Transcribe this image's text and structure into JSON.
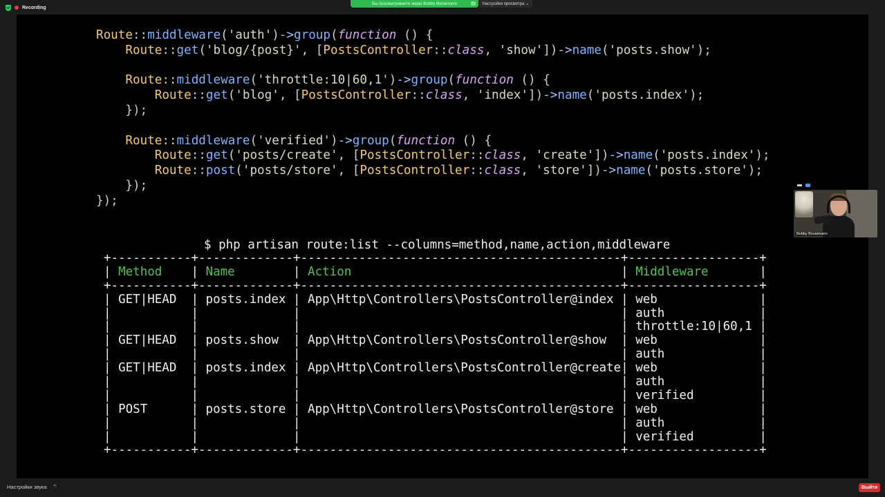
{
  "topbar": {
    "recording_label": "Recording",
    "share_banner_text": "Вы просматриваете экран Bobby Bouwmann",
    "view_options_label": "Настройки просмотра",
    "view_options_caret": "⌄"
  },
  "code_lines": [
    [
      {
        "c": "k-route",
        "t": "Route"
      },
      {
        "c": "k-pun",
        "t": "::"
      },
      {
        "c": "k-fn",
        "t": "middleware"
      },
      {
        "c": "k-pun",
        "t": "("
      },
      {
        "c": "k-str",
        "t": "'auth'"
      },
      {
        "c": "k-pun",
        "t": ")"
      },
      {
        "c": "k-arrow",
        "t": "->"
      },
      {
        "c": "k-fn",
        "t": "group"
      },
      {
        "c": "k-pun",
        "t": "("
      },
      {
        "c": "k-kw",
        "t": "function"
      },
      {
        "c": "k-pun",
        "t": " () {"
      }
    ],
    [
      {
        "c": "k-pun",
        "t": "    "
      },
      {
        "c": "k-route",
        "t": "Route"
      },
      {
        "c": "k-pun",
        "t": "::"
      },
      {
        "c": "k-fn",
        "t": "get"
      },
      {
        "c": "k-pun",
        "t": "("
      },
      {
        "c": "k-str",
        "t": "'blog/{post}'"
      },
      {
        "c": "k-pun",
        "t": ", ["
      },
      {
        "c": "k-cls",
        "t": "PostsController"
      },
      {
        "c": "k-pun",
        "t": "::"
      },
      {
        "c": "k-kw",
        "t": "class"
      },
      {
        "c": "k-pun",
        "t": ", "
      },
      {
        "c": "k-str",
        "t": "'show'"
      },
      {
        "c": "k-pun",
        "t": "])"
      },
      {
        "c": "k-arrow",
        "t": "->"
      },
      {
        "c": "k-fn",
        "t": "name"
      },
      {
        "c": "k-pun",
        "t": "("
      },
      {
        "c": "k-str",
        "t": "'posts.show'"
      },
      {
        "c": "k-pun",
        "t": ");"
      }
    ],
    [],
    [
      {
        "c": "k-pun",
        "t": "    "
      },
      {
        "c": "k-route",
        "t": "Route"
      },
      {
        "c": "k-pun",
        "t": "::"
      },
      {
        "c": "k-fn",
        "t": "middleware"
      },
      {
        "c": "k-pun",
        "t": "("
      },
      {
        "c": "k-str",
        "t": "'throttle:10|60,1'"
      },
      {
        "c": "k-pun",
        "t": ")"
      },
      {
        "c": "k-arrow",
        "t": "->"
      },
      {
        "c": "k-fn",
        "t": "group"
      },
      {
        "c": "k-pun",
        "t": "("
      },
      {
        "c": "k-kw",
        "t": "function"
      },
      {
        "c": "k-pun",
        "t": " () {"
      }
    ],
    [
      {
        "c": "k-pun",
        "t": "        "
      },
      {
        "c": "k-route",
        "t": "Route"
      },
      {
        "c": "k-pun",
        "t": "::"
      },
      {
        "c": "k-fn",
        "t": "get"
      },
      {
        "c": "k-pun",
        "t": "("
      },
      {
        "c": "k-str",
        "t": "'blog'"
      },
      {
        "c": "k-pun",
        "t": ", ["
      },
      {
        "c": "k-cls",
        "t": "PostsController"
      },
      {
        "c": "k-pun",
        "t": "::"
      },
      {
        "c": "k-kw",
        "t": "class"
      },
      {
        "c": "k-pun",
        "t": ", "
      },
      {
        "c": "k-str",
        "t": "'index'"
      },
      {
        "c": "k-pun",
        "t": "])"
      },
      {
        "c": "k-arrow",
        "t": "->"
      },
      {
        "c": "k-fn",
        "t": "name"
      },
      {
        "c": "k-pun",
        "t": "("
      },
      {
        "c": "k-str",
        "t": "'posts.index'"
      },
      {
        "c": "k-pun",
        "t": ");"
      }
    ],
    [
      {
        "c": "k-pun",
        "t": "    });"
      }
    ],
    [],
    [
      {
        "c": "k-pun",
        "t": "    "
      },
      {
        "c": "k-route",
        "t": "Route"
      },
      {
        "c": "k-pun",
        "t": "::"
      },
      {
        "c": "k-fn",
        "t": "middleware"
      },
      {
        "c": "k-pun",
        "t": "("
      },
      {
        "c": "k-str",
        "t": "'verified'"
      },
      {
        "c": "k-pun",
        "t": ")"
      },
      {
        "c": "k-arrow",
        "t": "->"
      },
      {
        "c": "k-fn",
        "t": "group"
      },
      {
        "c": "k-pun",
        "t": "("
      },
      {
        "c": "k-kw",
        "t": "function"
      },
      {
        "c": "k-pun",
        "t": " () {"
      }
    ],
    [
      {
        "c": "k-pun",
        "t": "        "
      },
      {
        "c": "k-route",
        "t": "Route"
      },
      {
        "c": "k-pun",
        "t": "::"
      },
      {
        "c": "k-fn",
        "t": "get"
      },
      {
        "c": "k-pun",
        "t": "("
      },
      {
        "c": "k-str",
        "t": "'posts/create'"
      },
      {
        "c": "k-pun",
        "t": ", ["
      },
      {
        "c": "k-cls",
        "t": "PostsController"
      },
      {
        "c": "k-pun",
        "t": "::"
      },
      {
        "c": "k-kw",
        "t": "class"
      },
      {
        "c": "k-pun",
        "t": ", "
      },
      {
        "c": "k-str",
        "t": "'create'"
      },
      {
        "c": "k-pun",
        "t": "])"
      },
      {
        "c": "k-arrow",
        "t": "->"
      },
      {
        "c": "k-fn",
        "t": "name"
      },
      {
        "c": "k-pun",
        "t": "("
      },
      {
        "c": "k-str",
        "t": "'posts.index'"
      },
      {
        "c": "k-pun",
        "t": ");"
      }
    ],
    [
      {
        "c": "k-pun",
        "t": "        "
      },
      {
        "c": "k-route",
        "t": "Route"
      },
      {
        "c": "k-pun",
        "t": "::"
      },
      {
        "c": "k-fn",
        "t": "post"
      },
      {
        "c": "k-pun",
        "t": "("
      },
      {
        "c": "k-str",
        "t": "'posts/store'"
      },
      {
        "c": "k-pun",
        "t": ", ["
      },
      {
        "c": "k-cls",
        "t": "PostsController"
      },
      {
        "c": "k-pun",
        "t": "::"
      },
      {
        "c": "k-kw",
        "t": "class"
      },
      {
        "c": "k-pun",
        "t": ", "
      },
      {
        "c": "k-str",
        "t": "'store'"
      },
      {
        "c": "k-pun",
        "t": "])"
      },
      {
        "c": "k-arrow",
        "t": "->"
      },
      {
        "c": "k-fn",
        "t": "name"
      },
      {
        "c": "k-pun",
        "t": "("
      },
      {
        "c": "k-str",
        "t": "'posts.store'"
      },
      {
        "c": "k-pun",
        "t": ");"
      }
    ],
    [
      {
        "c": "k-pun",
        "t": "    });"
      }
    ],
    [
      {
        "c": "k-pun",
        "t": "});"
      }
    ]
  ],
  "terminal": {
    "command": "$ php artisan route:list --columns=method,name,action,middleware",
    "border_line": "+-----------+-------------+--------------------------------------------+------------------+",
    "headers": [
      "Method",
      "Name",
      "Action",
      "Middleware"
    ],
    "rows": [
      {
        "method": "GET|HEAD",
        "name": "posts.index",
        "action": "App\\Http\\Controllers\\PostsController@index",
        "middleware": [
          "web",
          "auth",
          "throttle:10|60,1"
        ]
      },
      {
        "method": "GET|HEAD",
        "name": "posts.show",
        "action": "App\\Http\\Controllers\\PostsController@show",
        "middleware": [
          "web",
          "auth"
        ]
      },
      {
        "method": "GET|HEAD",
        "name": "posts.index",
        "action": "App\\Http\\Controllers\\PostsController@create",
        "middleware": [
          "web",
          "auth",
          "verified"
        ]
      },
      {
        "method": "POST",
        "name": "posts.store",
        "action": "App\\Http\\Controllers\\PostsController@store",
        "middleware": [
          "web",
          "auth",
          "verified"
        ]
      }
    ]
  },
  "participant": {
    "name": "Bobby Bouwmann"
  },
  "bottombar": {
    "audio_settings_label": "Настройки звука",
    "audio_caret": "^",
    "leave_label": "Выйти"
  },
  "colors": {
    "accent_green": "#2fbb4f",
    "leave_red": "#d12f2f",
    "table_header_green": "#56c058"
  }
}
